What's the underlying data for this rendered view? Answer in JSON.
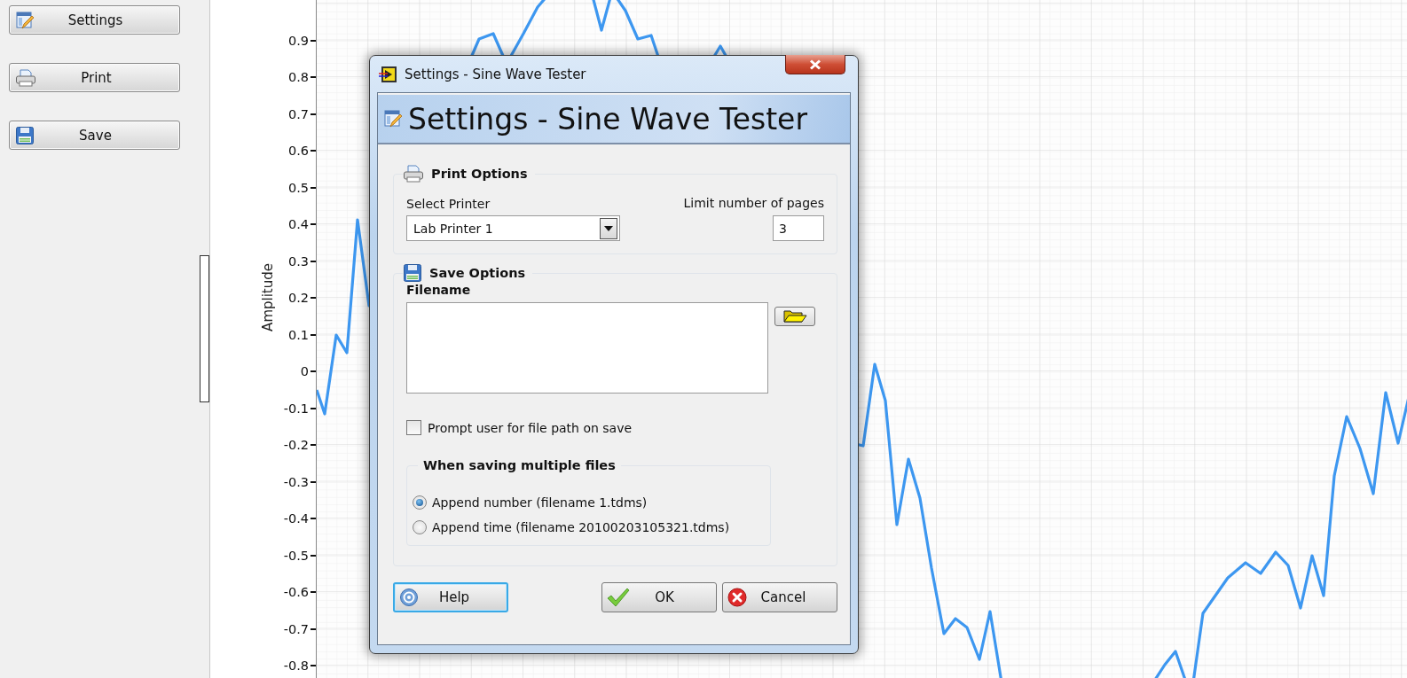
{
  "sidebar": {
    "buttons": [
      {
        "label": "Settings",
        "kind": "settings"
      },
      {
        "label": "Print",
        "kind": "print"
      },
      {
        "label": "Save",
        "kind": "save"
      }
    ]
  },
  "graph": {
    "y_axis_label": "Amplitude",
    "y_ticks": [
      "0.9",
      "0.8",
      "0.7",
      "0.6",
      "0.5",
      "0.4",
      "0.3",
      "0.2",
      "0.1",
      "0",
      "-0.1",
      "-0.2",
      "-0.3",
      "-0.4",
      "-0.5",
      "-0.6",
      "-0.7",
      "-0.8"
    ]
  },
  "dialog": {
    "title": "Settings - Sine Wave Tester",
    "heading": "Settings - Sine Wave Tester",
    "print_options": {
      "title": "Print Options",
      "printer_label": "Select Printer",
      "printer_value": "Lab Printer 1",
      "pages_label": "Limit number of pages",
      "pages_value": "3"
    },
    "save_options": {
      "title": "Save Options",
      "filename_label": "Filename",
      "prompt": {
        "label": "Prompt user for file path on save",
        "checked": false
      },
      "multiple_files": {
        "title": "When saving multiple files",
        "options": [
          {
            "label": "Append number (filename 1.tdms)",
            "selected": true
          },
          {
            "label": "Append time (filename 20100203105321.tdms)",
            "selected": false
          }
        ]
      }
    },
    "buttons": [
      {
        "label": "Help",
        "kind": "help",
        "focused": true
      },
      {
        "label": "OK",
        "kind": "ok",
        "focused": false
      },
      {
        "label": "Cancel",
        "kind": "cancel",
        "focused": false
      }
    ]
  }
}
